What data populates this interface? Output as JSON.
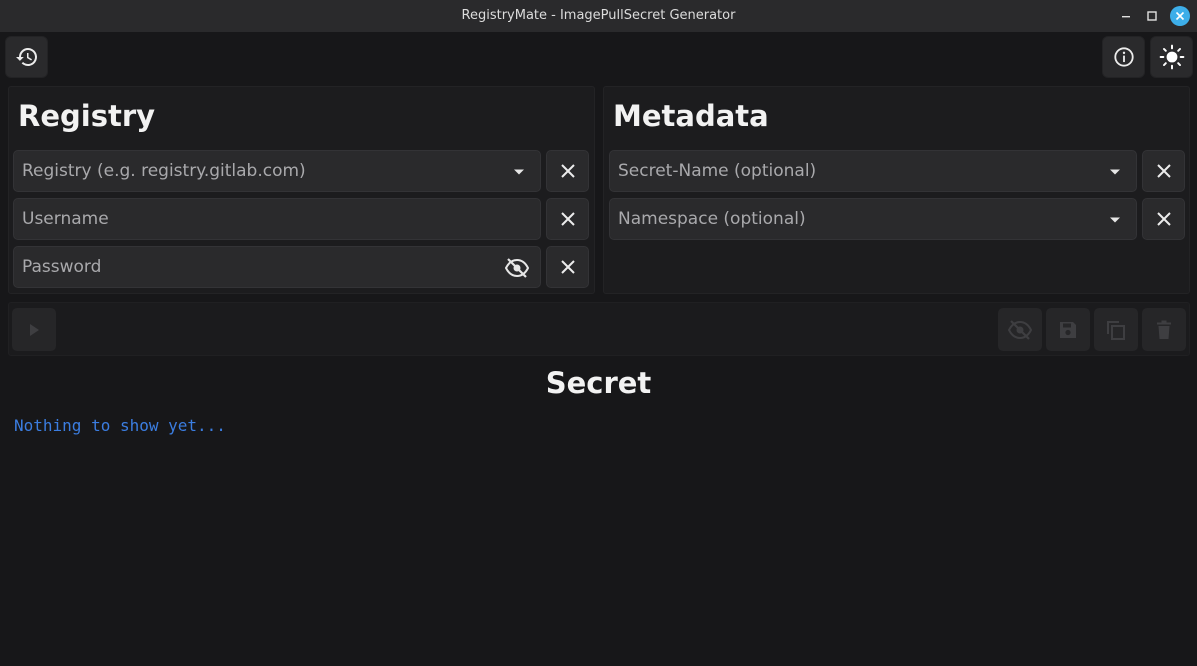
{
  "window": {
    "title": "RegistryMate - ImagePullSecret Generator",
    "accent_color": "#3daee9"
  },
  "toolbar": {
    "left_icons": [
      "history-icon"
    ],
    "right_icons": [
      "info-icon",
      "sun-icon"
    ]
  },
  "registry_panel": {
    "heading": "Registry",
    "fields": [
      {
        "placeholder": "Registry (e.g. registry.gitlab.com)",
        "value": "",
        "trailing_icon": "dropdown-arrow-icon"
      },
      {
        "placeholder": "Username",
        "value": ""
      },
      {
        "placeholder": "Password",
        "value": "",
        "trailing_icon": "eye-off-icon"
      }
    ]
  },
  "metadata_panel": {
    "heading": "Metadata",
    "fields": [
      {
        "placeholder": "Secret-Name (optional)",
        "value": "",
        "trailing_icon": "dropdown-arrow-icon"
      },
      {
        "placeholder": "Namespace (optional)",
        "value": "",
        "trailing_icon": "dropdown-arrow-icon"
      }
    ]
  },
  "actions": {
    "left": [
      "play-icon"
    ],
    "right": [
      "eye-off-icon",
      "save-icon",
      "copy-icon",
      "delete-icon"
    ],
    "enabled": false
  },
  "secret": {
    "heading": "Secret",
    "content": "Nothing to show yet...",
    "content_color": "#3b7de0"
  }
}
